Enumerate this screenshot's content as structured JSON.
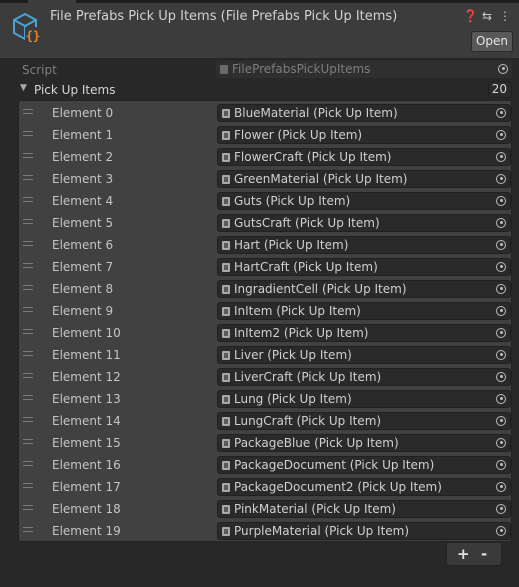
{
  "header": {
    "title": "File Prefabs Pick Up Items (File Prefabs Pick Up Items)",
    "help_icon": "help-icon",
    "preset_icon": "preset-icon",
    "menu_icon": "kebab-menu-icon",
    "open_label": "Open"
  },
  "script": {
    "label": "Script",
    "value": "FilePrefabsPickUpItems"
  },
  "list": {
    "label": "Pick Up Items",
    "count": "20",
    "elements": [
      {
        "label": "Element 0",
        "value": "BlueMaterial (Pick Up Item)"
      },
      {
        "label": "Element 1",
        "value": "Flower (Pick Up Item)"
      },
      {
        "label": "Element 2",
        "value": "FlowerCraft (Pick Up Item)"
      },
      {
        "label": "Element 3",
        "value": "GreenMaterial (Pick Up Item)"
      },
      {
        "label": "Element 4",
        "value": "Guts (Pick Up Item)"
      },
      {
        "label": "Element 5",
        "value": "GutsCraft (Pick Up Item)"
      },
      {
        "label": "Element 6",
        "value": "Hart (Pick Up Item)"
      },
      {
        "label": "Element 7",
        "value": "HartCraft (Pick Up Item)"
      },
      {
        "label": "Element 8",
        "value": "IngradientCell (Pick Up Item)"
      },
      {
        "label": "Element 9",
        "value": "InItem (Pick Up Item)"
      },
      {
        "label": "Element 10",
        "value": "InItem2 (Pick Up Item)"
      },
      {
        "label": "Element 11",
        "value": "Liver (Pick Up Item)"
      },
      {
        "label": "Element 12",
        "value": "LiverCraft (Pick Up Item)"
      },
      {
        "label": "Element 13",
        "value": "Lung (Pick Up Item)"
      },
      {
        "label": "Element 14",
        "value": "LungCraft (Pick Up Item)"
      },
      {
        "label": "Element 15",
        "value": "PackageBlue (Pick Up Item)"
      },
      {
        "label": "Element 16",
        "value": "PackageDocument (Pick Up Item)"
      },
      {
        "label": "Element 17",
        "value": "PackageDocument2 (Pick Up Item)"
      },
      {
        "label": "Element 18",
        "value": "PinkMaterial (Pick Up Item)"
      },
      {
        "label": "Element 19",
        "value": "PurpleMaterial (Pick Up Item)"
      }
    ]
  },
  "footer": {
    "add_label": "+",
    "remove_label": "-"
  },
  "colors": {
    "background": "#282828",
    "header": "#3c3c3c",
    "list_background": "#414141",
    "field_background": "#2a2a2a",
    "icon_accent_blue": "#4aa3d8",
    "icon_accent_orange": "#e8862a"
  }
}
